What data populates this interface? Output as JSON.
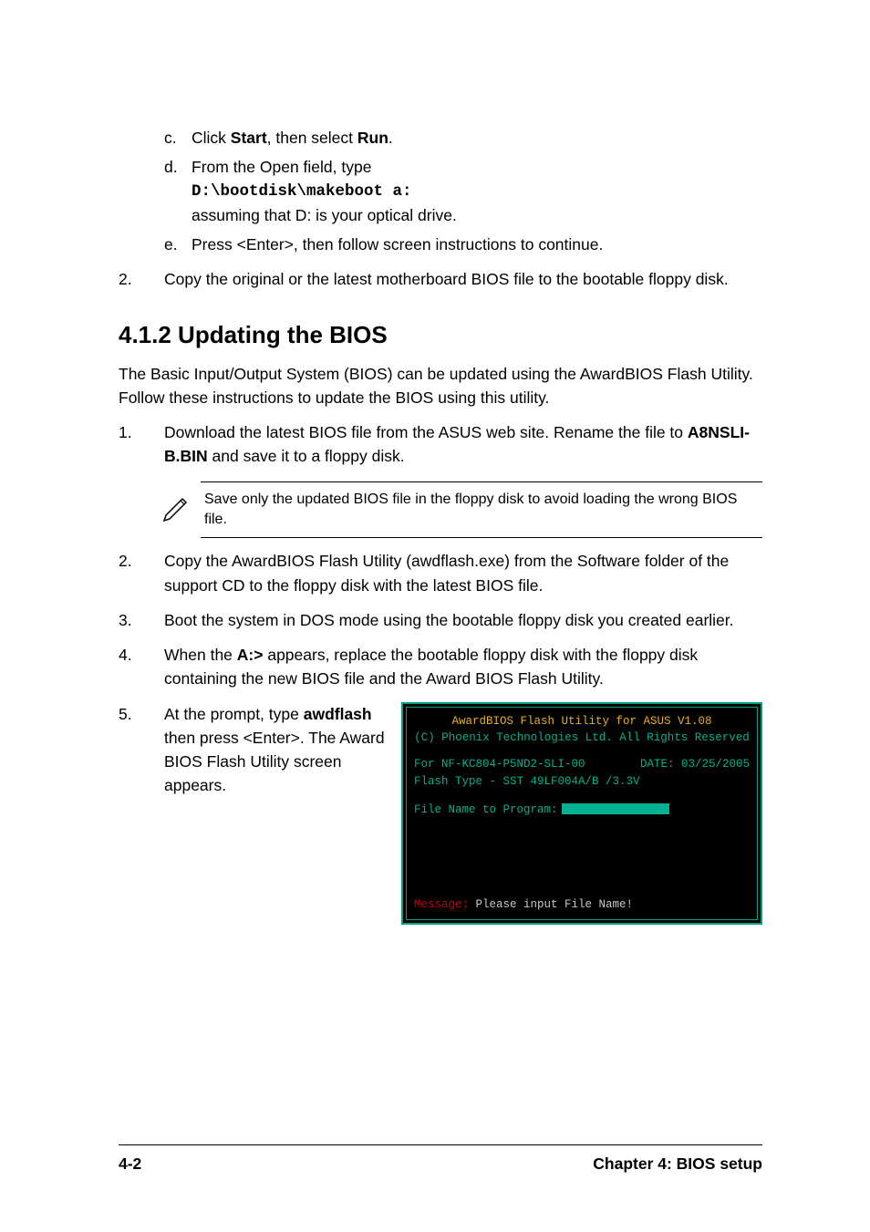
{
  "sub_c_letter": "c.",
  "sub_c_prefix": "Click ",
  "sub_c_start": "Start",
  "sub_c_mid": ", then select ",
  "sub_c_run": "Run",
  "sub_c_suffix": ".",
  "sub_d_letter": "d.",
  "sub_d_line1": "From the Open field, type",
  "sub_d_cmd": "D:\\bootdisk\\makeboot a:",
  "sub_d_line2": "assuming that D: is your optical drive.",
  "sub_e_letter": "e.",
  "sub_e_text": "Press <Enter>, then follow screen instructions to continue.",
  "step_top_num": "2.",
  "step_top_text": "Copy the original or the latest motherboard BIOS file to the bootable floppy disk.",
  "section_heading": "4.1.2   Updating the BIOS",
  "intro_paragraph": "The Basic Input/Output System (BIOS) can be updated using the AwardBIOS Flash Utility. Follow these instructions to update the BIOS using this utility.",
  "s1_num": "1.",
  "s1_prefix": "Download the latest BIOS file from the ASUS web site. Rename the file to ",
  "s1_filename": "A8NSLI-B.BIN",
  "s1_suffix": " and save it to a floppy disk.",
  "note_text": "Save only the updated BIOS file in the floppy disk to avoid loading the wrong BIOS file.",
  "s2_num": "2.",
  "s2_text": "Copy the AwardBIOS Flash Utility (awdflash.exe) from the Software folder of the support CD to the floppy disk with the latest BIOS file.",
  "s3_num": "3.",
  "s3_text": "Boot the system in DOS mode using the bootable floppy disk you created earlier.",
  "s4_num": "4.",
  "s4_prefix": "When the ",
  "s4_prompt": "A:>",
  "s4_suffix": " appears, replace the bootable floppy disk with the floppy disk containing the new BIOS file and the Award BIOS Flash Utility.",
  "s5_num": "5.",
  "s5_prefix": "At the prompt, type ",
  "s5_cmd": "awdflash",
  "s5_suffix": " then press <Enter>. The Award BIOS Flash Utility screen appears.",
  "bios_title": "AwardBIOS Flash Utility for ASUS V1.08",
  "bios_copyright": "(C) Phoenix Technologies Ltd. All Rights Reserved",
  "bios_for": "For NF-KC804-P5ND2-SLI-00",
  "bios_date": "DATE: 03/25/2005",
  "bios_flash": "Flash Type - SST 49LF004A/B /3.3V",
  "bios_prompt": "File Name to Program:",
  "bios_msg_label": "Message:",
  "bios_msg_text": " Please input File Name!",
  "footer_left": "4-2",
  "footer_right": "Chapter 4: BIOS setup"
}
